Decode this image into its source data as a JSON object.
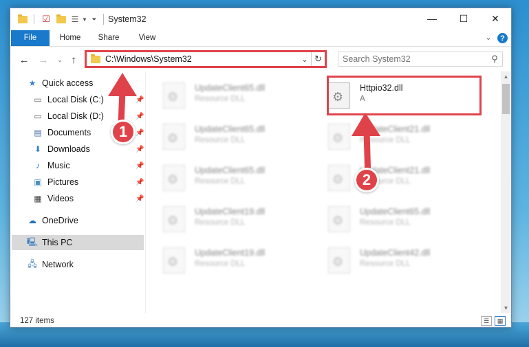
{
  "window": {
    "title": "System32",
    "minimize": "—",
    "maximize": "☐",
    "close": "✕"
  },
  "ribbon": {
    "tabs": [
      "File",
      "Home",
      "Share",
      "View"
    ],
    "expand": "⌄",
    "help": "?"
  },
  "address": {
    "path": "C:\\Windows\\System32",
    "search_placeholder": "Search System32"
  },
  "nav": {
    "items": [
      {
        "label": "Quick access",
        "icon": "star-icon"
      },
      {
        "label": "Local Disk (C:)",
        "icon": "drive-icon",
        "pinned": true
      },
      {
        "label": "Local Disk (D:)",
        "icon": "drive-icon",
        "pinned": true
      },
      {
        "label": "Documents",
        "icon": "documents-icon",
        "pinned": true
      },
      {
        "label": "Downloads",
        "icon": "download-icon",
        "pinned": true
      },
      {
        "label": "Music",
        "icon": "music-icon",
        "pinned": true
      },
      {
        "label": "Pictures",
        "icon": "pictures-icon",
        "pinned": true
      },
      {
        "label": "Videos",
        "icon": "videos-icon",
        "pinned": true
      },
      {
        "label": "OneDrive",
        "icon": "cloud-icon"
      },
      {
        "label": "This PC",
        "icon": "computer-icon",
        "selected": true
      },
      {
        "label": "Network",
        "icon": "network-icon"
      }
    ]
  },
  "files": {
    "left_column": [
      {
        "name": "UpdateClient65.dll",
        "type": "Resource DLL"
      },
      {
        "name": "UpdateClient65.dll",
        "type": "Resource DLL"
      },
      {
        "name": "UpdateClient65.dll",
        "type": "Resource DLL"
      },
      {
        "name": "UpdateClient19.dll",
        "type": "Resource DLL"
      },
      {
        "name": "UpdateClient19.dll",
        "type": "Resource DLL"
      }
    ],
    "right_column": [
      {
        "name": "Httpio32.dll",
        "type": "A"
      },
      {
        "name": "UpdateClient21.dll",
        "type": "Resource DLL"
      },
      {
        "name": "UpdateClient21.dll",
        "type": "Resource DLL"
      },
      {
        "name": "UpdateClient65.dll",
        "type": "Resource DLL"
      },
      {
        "name": "UpdateClient42.dll",
        "type": "Resource DLL"
      }
    ]
  },
  "status": {
    "items_count": "127 items"
  },
  "callouts": {
    "step1": "1",
    "step2": "2"
  },
  "colors": {
    "accent": "#1979ca",
    "highlight": "#e0424a"
  }
}
